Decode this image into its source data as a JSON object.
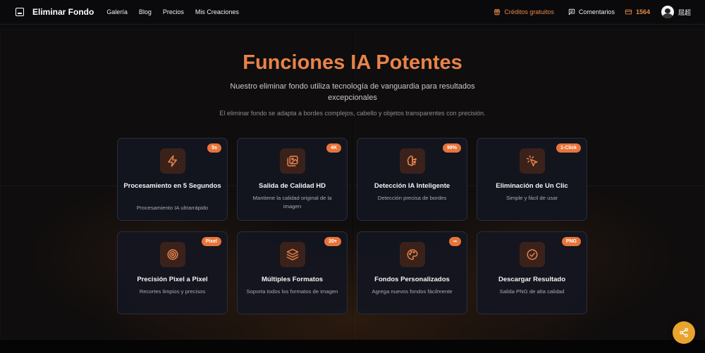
{
  "nav": {
    "brand": "Eliminar Fondo",
    "links": [
      "Galería",
      "Blog",
      "Precios",
      "Mis Creaciones"
    ],
    "credits_label": "Créditos gratuitos",
    "comments_label": "Comentarios",
    "credits_count": "1564",
    "username": "屈超"
  },
  "hero": {
    "title": "Funciones IA Potentes",
    "subtitle": "Nuestro eliminar fondo utiliza tecnología de vanguardia para resultados excepcionales",
    "note": "El eliminar fondo se adapta a bordes complejos, cabello y objetos transparentes con precisión."
  },
  "features": [
    {
      "badge": "5s",
      "icon": "lightning-icon",
      "title": "Procesamiento en 5 Segundos",
      "desc": "Procesamiento IA ultrarrápido"
    },
    {
      "badge": "4K",
      "icon": "image-quality-icon",
      "title": "Salida de Calidad HD",
      "desc": "Mantiene la calidad original de la imagen"
    },
    {
      "badge": "99%",
      "icon": "brain-icon",
      "title": "Detección IA Inteligente",
      "desc": "Detección precisa de bordes"
    },
    {
      "badge": "1-Click",
      "icon": "pointer-click-icon",
      "title": "Eliminación de Un Clic",
      "desc": "Simple y fácil de usar"
    },
    {
      "badge": "Pixel",
      "icon": "target-icon",
      "title": "Precisión Pixel a Pixel",
      "desc": "Recortes limpios y precisos"
    },
    {
      "badge": "20+",
      "icon": "layers-icon",
      "title": "Múltiples Formatos",
      "desc": "Soporta todos los formatos de imagen"
    },
    {
      "badge": "∞",
      "icon": "palette-icon",
      "title": "Fondos Personalizados",
      "desc": "Agrega nuevos fondos fácilmente"
    },
    {
      "badge": "PNG",
      "icon": "check-circle-icon",
      "title": "Descargar Resultado",
      "desc": "Salida PNG de alta calidad"
    }
  ],
  "colors": {
    "accent": "#e8834a",
    "badge": "#e8743a",
    "share_button": "#e8a42e",
    "card_bg": "#141620"
  }
}
